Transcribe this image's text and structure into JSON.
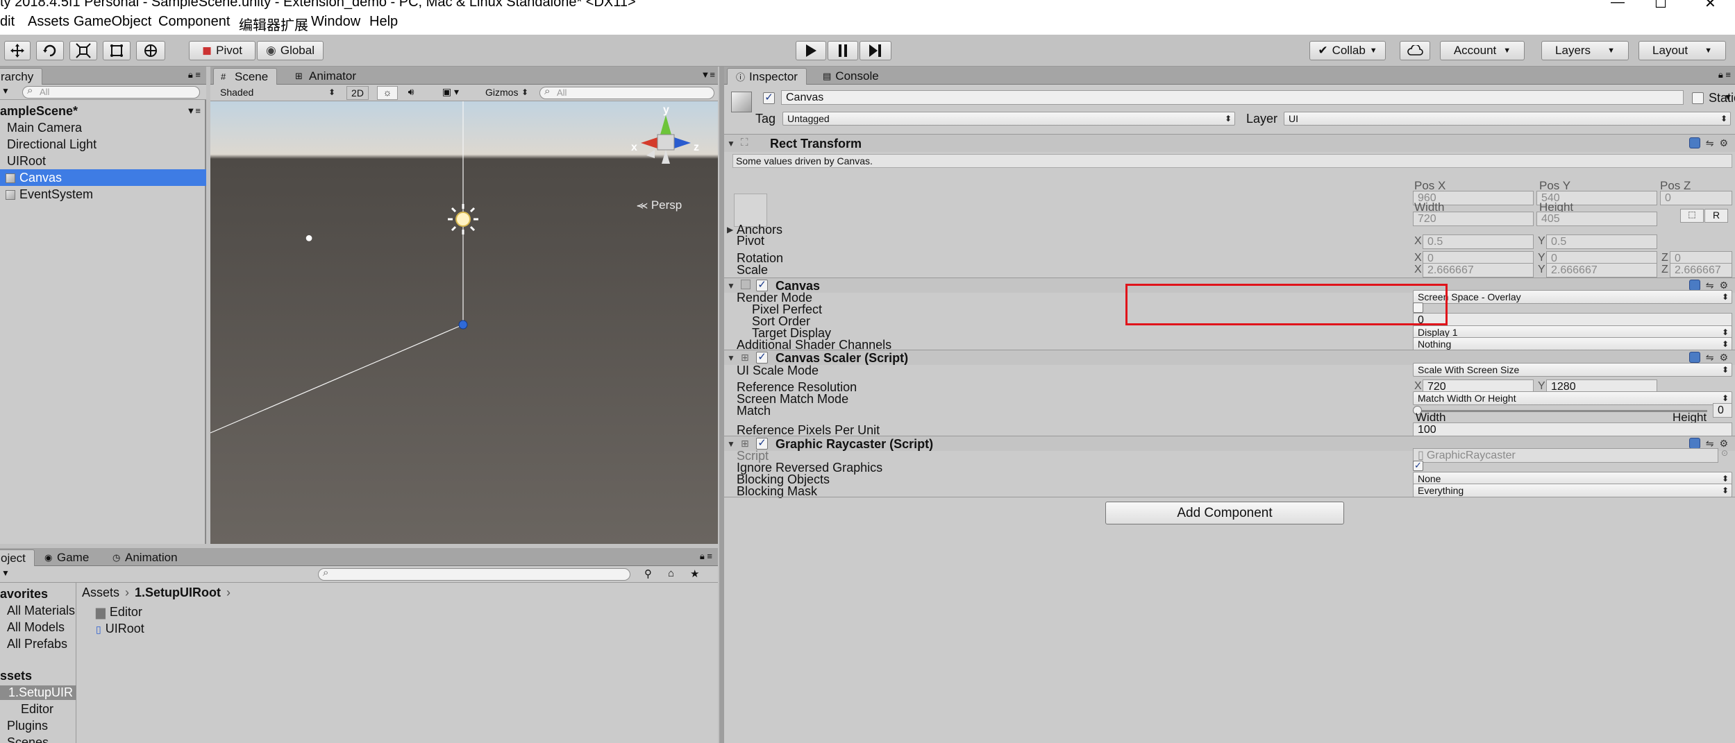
{
  "window": {
    "title": "ty 2018.4.5f1 Personal - SampleScene.unity - Extension_demo - PC, Mac & Linux Standalone* <DX11>"
  },
  "menu": [
    "dit",
    "Assets",
    "GameObject",
    "Component",
    "编辑器扩展",
    "Window",
    "Help"
  ],
  "toolbar": {
    "pivot": "Pivot",
    "global": "Global",
    "collab": "Collab",
    "account": "Account",
    "layers": "Layers",
    "layout": "Layout"
  },
  "hierarchy": {
    "tab": "rarchy",
    "search_placeholder": "All",
    "scene_name": "ampleScene*",
    "items": [
      "Main Camera",
      "Directional Light",
      "UIRoot",
      "Canvas",
      "EventSystem"
    ],
    "selected": "Canvas"
  },
  "scene": {
    "tabs": [
      "Scene",
      "Animator"
    ],
    "shading": "Shaded",
    "mode_2d": "2D",
    "gizmos": "Gizmos",
    "search_placeholder": "All",
    "persp": "Persp",
    "axis_y": "y",
    "axis_x": "x",
    "axis_z": "z"
  },
  "project": {
    "tabs": [
      "oject",
      "Game",
      "Animation"
    ],
    "breadcrumb": [
      "Assets",
      "1.SetupUIRoot"
    ],
    "favorites_header": "avorites",
    "favorites": [
      "All Materials",
      "All Models",
      "All Prefabs"
    ],
    "assets_header": "ssets",
    "assets": [
      "1.SetupUIR",
      "Editor",
      "Plugins",
      "Scenes"
    ],
    "files": [
      "Editor",
      "UIRoot"
    ]
  },
  "inspector": {
    "tabs": [
      "Inspector",
      "Console"
    ],
    "object_name": "Canvas",
    "static_label": "Static",
    "tag_label": "Tag",
    "tag_value": "Untagged",
    "layer_label": "Layer",
    "layer_value": "UI",
    "rect_transform": {
      "title": "Rect Transform",
      "note": "Some values driven by Canvas.",
      "pos_x_label": "Pos X",
      "pos_x": "960",
      "pos_y_label": "Pos Y",
      "pos_y": "540",
      "pos_z_label": "Pos Z",
      "pos_z": "0",
      "width_label": "Width",
      "width": "720",
      "height_label": "Height",
      "height": "405",
      "anchors_label": "Anchors",
      "pivot_label": "Pivot",
      "pivot_x": "0.5",
      "pivot_y": "0.5",
      "rotation_label": "Rotation",
      "rot_x": "0",
      "rot_y": "0",
      "rot_z": "0",
      "scale_label": "Scale",
      "scale_x": "2.666667",
      "scale_y": "2.666667",
      "scale_z": "2.666667",
      "r_button": "R"
    },
    "canvas": {
      "title": "Canvas",
      "render_mode_label": "Render Mode",
      "render_mode": "Screen Space - Overlay",
      "pixel_perfect_label": "Pixel Perfect",
      "sort_order_label": "Sort Order",
      "sort_order": "0",
      "target_display_label": "Target Display",
      "target_display": "Display 1",
      "shader_channels_label": "Additional Shader Channels",
      "shader_channels": "Nothing"
    },
    "canvas_scaler": {
      "title": "Canvas Scaler (Script)",
      "ui_scale_mode_label": "UI Scale Mode",
      "ui_scale_mode": "Scale With Screen Size",
      "ref_res_label": "Reference Resolution",
      "ref_x": "720",
      "ref_y": "1280",
      "match_mode_label": "Screen Match Mode",
      "match_mode": "Match Width Or Height",
      "match_label": "Match",
      "match_value": "0",
      "width_caption": "Width",
      "height_caption": "Height",
      "ppu_label": "Reference Pixels Per Unit",
      "ppu": "100"
    },
    "raycaster": {
      "title": "Graphic Raycaster (Script)",
      "script_label": "Script",
      "script_value": "GraphicRaycaster",
      "ignore_reversed_label": "Ignore Reversed Graphics",
      "blocking_objects_label": "Blocking Objects",
      "blocking_objects": "None",
      "blocking_mask_label": "Blocking Mask",
      "blocking_mask": "Everything"
    },
    "add_component": "Add Component"
  },
  "colors": {
    "selection": "#3e7ce4",
    "highlight_box": "#e0141b"
  }
}
